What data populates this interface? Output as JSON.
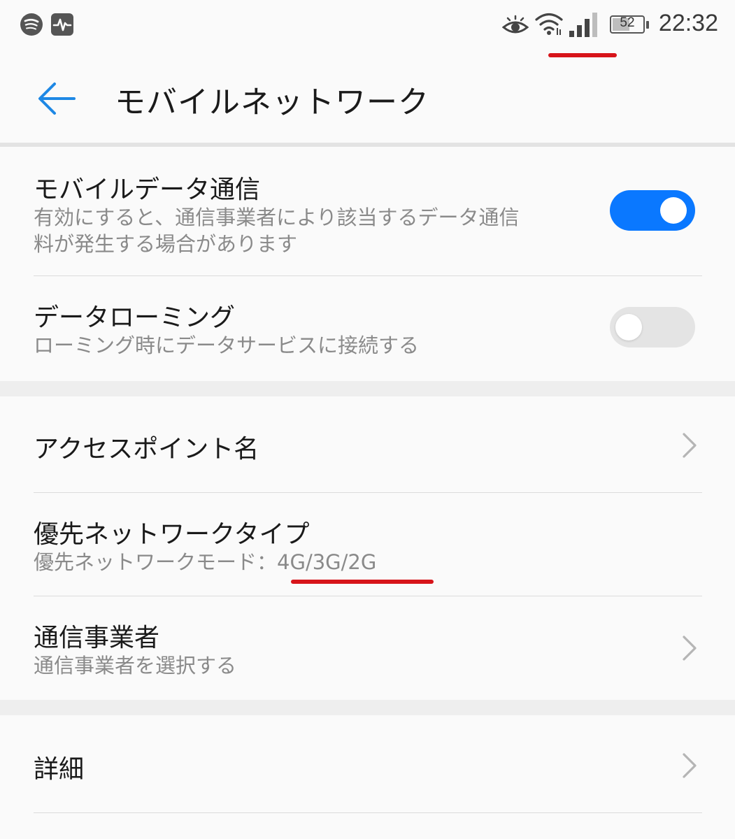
{
  "status_bar": {
    "time": "22:32",
    "battery_level": "52",
    "left_icons": [
      "spotify-icon",
      "activity-icon"
    ],
    "right_icons": [
      "eye-icon",
      "wifi-icon",
      "signal-icon",
      "battery-icon"
    ]
  },
  "header": {
    "title": "モバイルネットワーク",
    "back_icon": "arrow-left-icon"
  },
  "settings": {
    "mobile_data": {
      "title": "モバイルデータ通信",
      "subtitle_line1": "有効にすると、通信事業者により該当するデータ通信",
      "subtitle_line2": "料が発生する場合があります",
      "enabled": true
    },
    "data_roaming": {
      "title": "データローミング",
      "subtitle": "ローミング時にデータサービスに接続する",
      "enabled": false
    },
    "access_point": {
      "title": "アクセスポイント名"
    },
    "preferred_network": {
      "title": "優先ネットワークタイプ",
      "subtitle_label": "優先ネットワークモード：",
      "subtitle_value": "4G/3G/2G"
    },
    "carrier": {
      "title": "通信事業者",
      "subtitle": "通信事業者を選択する"
    },
    "advanced": {
      "title": "詳細"
    }
  },
  "colors": {
    "accent": "#0a78ff",
    "back_arrow": "#1e88e5",
    "annotation": "#d7141a",
    "subtitle_text": "#8a8a8a"
  }
}
